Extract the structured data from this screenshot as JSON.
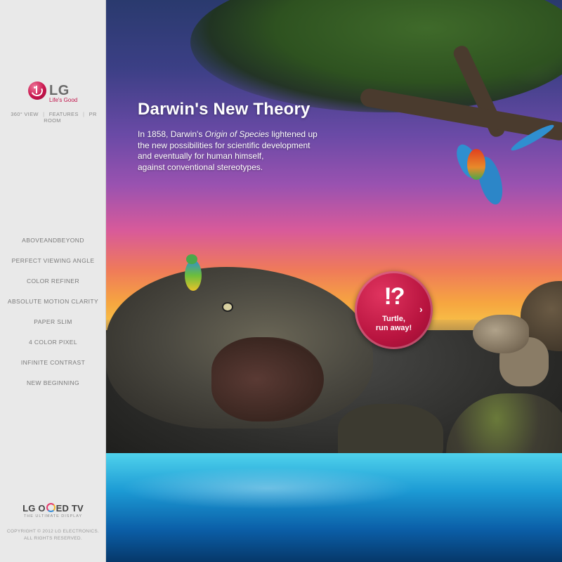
{
  "brand": {
    "logo_text": "LG",
    "tagline": "Life's Good",
    "accent_color": "#c8164e"
  },
  "topnav": {
    "items": [
      "360° VIEW",
      "FEATURES",
      "PR ROOM"
    ],
    "separator": "|"
  },
  "menu": {
    "items": [
      "ABOVEANDBEYOND",
      "PERFECT VIEWING ANGLE",
      "COLOR REFINER",
      "ABSOLUTE MOTION CLARITY",
      "PAPER SLIM",
      "4 COLOR PIXEL",
      "INFINITE CONTRAST",
      "NEW BEGINNING"
    ]
  },
  "footer": {
    "oled_prefix": "LG O",
    "oled_suffix": "ED TV",
    "oled_subtitle": "THE ULTIMATE DISPLAY",
    "copyright_line1": "COPYRIGHT © 2012 LG ELECTRONICS.",
    "copyright_line2": "ALL RIGHTS RESERVED."
  },
  "main": {
    "headline": "Darwin's New Theory",
    "body_before": "In 1858, Darwin's ",
    "body_italic": "Origin of Species",
    "body_line1_after": " lightened up",
    "body_line2": "the new possibilities for scientific development",
    "body_line3": "and eventually for human himself,",
    "body_line4": "against conventional stereotypes."
  },
  "cta": {
    "mark": "!?",
    "line1": "Turtle,",
    "line2": "run away!",
    "arrow": "›",
    "color": "#b8143f"
  }
}
